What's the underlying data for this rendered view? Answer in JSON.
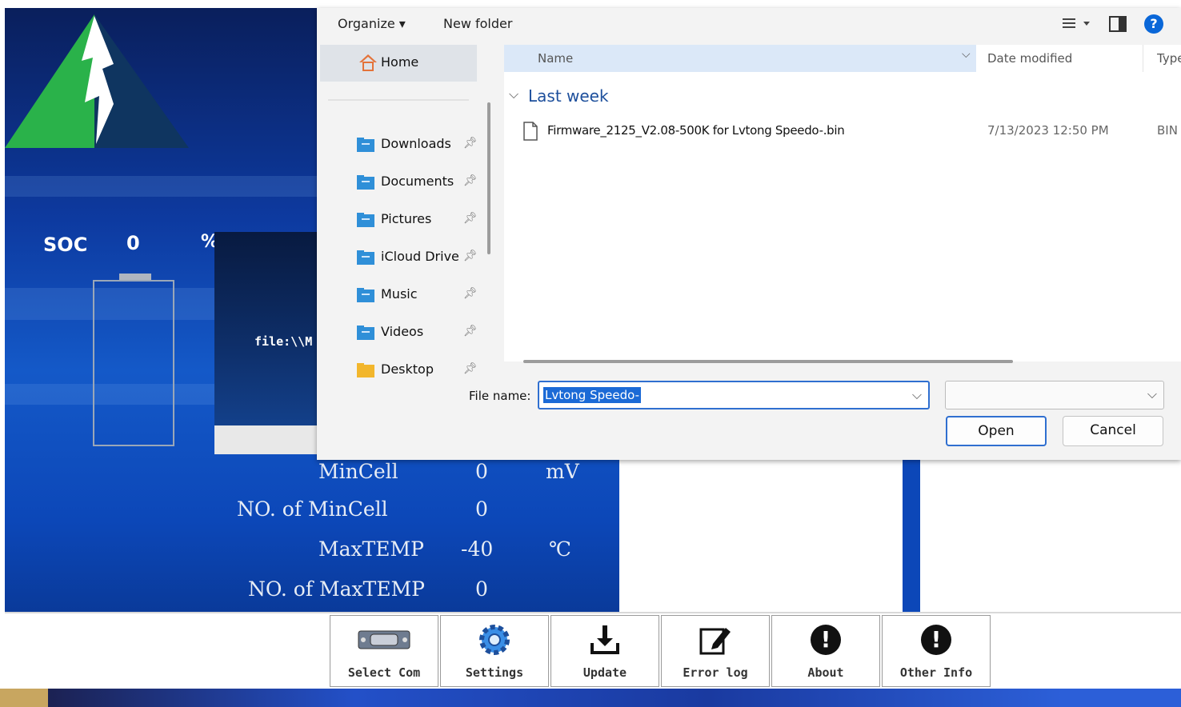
{
  "app": {
    "soc": {
      "label": "SOC",
      "value": "0",
      "unit": "%"
    },
    "file_path": "file:\\\\M",
    "metrics": [
      {
        "label": "MinCell",
        "value": "0",
        "unit": "mV"
      },
      {
        "label": "NO. of MinCell",
        "value": "0",
        "unit": ""
      },
      {
        "label": "MaxTEMP",
        "value": "-40",
        "unit": "℃"
      },
      {
        "label": "NO. of MaxTEMP",
        "value": "0",
        "unit": ""
      }
    ],
    "taskbar": [
      {
        "label": "Select Com",
        "icon": "serial-port-icon"
      },
      {
        "label": "Settings",
        "icon": "gear-icon"
      },
      {
        "label": "Update",
        "icon": "download-icon"
      },
      {
        "label": "Error log",
        "icon": "edit-note-icon"
      },
      {
        "label": "About",
        "icon": "exclamation-icon"
      },
      {
        "label": "Other Info",
        "icon": "exclamation-icon"
      }
    ],
    "colors": {
      "primary_blue": "#0d3aa0",
      "logo_green": "#2ab24a",
      "logo_navy": "#0f3560"
    }
  },
  "dialog": {
    "toolbar": {
      "organize": "Organize ▾",
      "new_folder": "New folder"
    },
    "nav": {
      "home": "Home",
      "items": [
        "Downloads",
        "Documents",
        "Pictures",
        "iCloud Drive",
        "Music",
        "Videos",
        "Desktop"
      ]
    },
    "columns": {
      "name": "Name",
      "date": "Date modified",
      "type": "Type"
    },
    "group": "Last week",
    "files": [
      {
        "name": "Firmware_2125_V2.08-500K for Lvtong Speedo-.bin",
        "date": "7/13/2023 12:50 PM",
        "type": "BIN"
      }
    ],
    "file_name_label": "File name:",
    "file_name_value": "Lvtong Speedo-",
    "open_label": "Open",
    "cancel_label": "Cancel"
  }
}
